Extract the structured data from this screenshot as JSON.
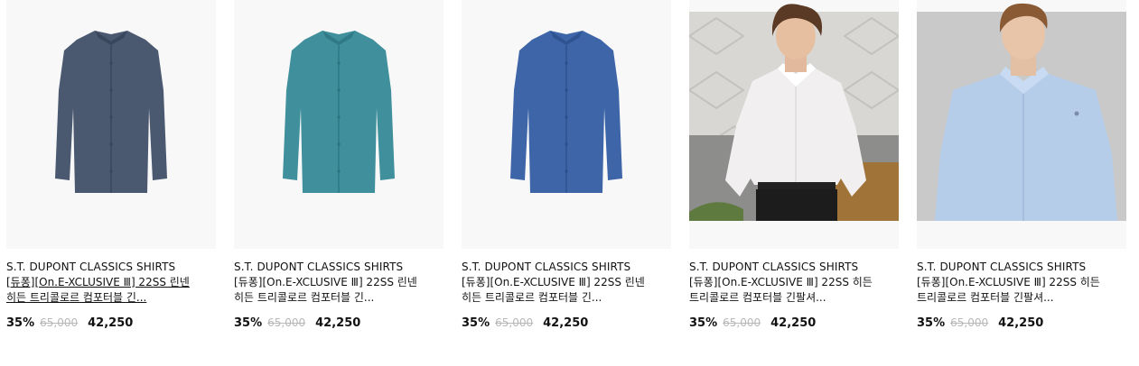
{
  "products": [
    {
      "brand": "S.T. DUPONT CLASSICS SHIRTS",
      "name": "[듀퐁][On.E-XCLUSIVE Ⅲ] 22SS 린넨 히든 트리콜로르 컴포터블 긴...",
      "discount": "35%",
      "original_price": "65,000",
      "sale_price": "42,250",
      "image": "navy shirt flat",
      "color": "#4a5870"
    },
    {
      "brand": "S.T. DUPONT CLASSICS SHIRTS",
      "name": "[듀퐁][On.E-XCLUSIVE Ⅲ] 22SS 린넨 히든 트리콜로르 컴포터블 긴...",
      "discount": "35%",
      "original_price": "65,000",
      "sale_price": "42,250",
      "image": "teal shirt flat",
      "color": "#3f8f9c"
    },
    {
      "brand": "S.T. DUPONT CLASSICS SHIRTS",
      "name": "[듀퐁][On.E-XCLUSIVE Ⅲ] 22SS 린넨 히든 트리콜로르 컴포터블 긴...",
      "discount": "35%",
      "original_price": "65,000",
      "sale_price": "42,250",
      "image": "blue shirt flat",
      "color": "#3d65a8"
    },
    {
      "brand": "S.T. DUPONT CLASSICS SHIRTS",
      "name": "[듀퐁][On.E-XCLUSIVE Ⅲ] 22SS 히든 트리콜로르 컴포터블 긴팔셔...",
      "discount": "35%",
      "original_price": "65,000",
      "sale_price": "42,250",
      "image": "model in white shirt",
      "color": "#f1eff0"
    },
    {
      "brand": "S.T. DUPONT CLASSICS SHIRTS",
      "name": "[듀퐁][On.E-XCLUSIVE Ⅲ] 22SS 히든 트리콜로르 컴포터블 긴팔셔...",
      "discount": "35%",
      "original_price": "65,000",
      "sale_price": "42,250",
      "image": "model in light blue shirt",
      "color": "#b6cdea"
    }
  ]
}
